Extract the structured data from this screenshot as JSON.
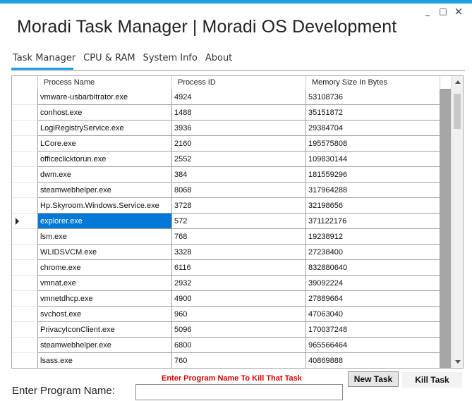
{
  "window": {
    "title": "Moradi Task Manager | Moradi OS Development",
    "minimize_glyph": "_",
    "maximize_glyph": "□",
    "close_glyph": "×",
    "accent_color": "#1ba1e2"
  },
  "tabs": [
    {
      "label": "Task Manager",
      "active": true
    },
    {
      "label": "CPU & RAM",
      "active": false
    },
    {
      "label": "System Info",
      "active": false
    },
    {
      "label": "About",
      "active": false
    }
  ],
  "grid": {
    "columns": [
      "Process Name",
      "Process ID",
      "Memory Size In Bytes"
    ],
    "selected_row": 8,
    "selection_color": "#0078d7",
    "rows": [
      [
        "vmware-usbarbitrator.exe",
        "4924",
        "53108736"
      ],
      [
        "conhost.exe",
        "1488",
        "35151872"
      ],
      [
        "LogiRegistryService.exe",
        "3936",
        "29384704"
      ],
      [
        "LCore.exe",
        "2160",
        "195575808"
      ],
      [
        "officeclicktorun.exe",
        "2552",
        "109830144"
      ],
      [
        "dwm.exe",
        "384",
        "181559296"
      ],
      [
        "steamwebhelper.exe",
        "8068",
        "317964288"
      ],
      [
        "Hp.Skyroom.Windows.Service.exe",
        "3728",
        "32198656"
      ],
      [
        "explorer.exe",
        "572",
        "371122176"
      ],
      [
        "lsm.exe",
        "768",
        "19238912"
      ],
      [
        "WLIDSVCM.exe",
        "3328",
        "27238400"
      ],
      [
        "chrome.exe",
        "6116",
        "832880640"
      ],
      [
        "vmnat.exe",
        "2932",
        "39092224"
      ],
      [
        "vmnetdhcp.exe",
        "4900",
        "27889664"
      ],
      [
        "svchost.exe",
        "960",
        "47063040"
      ],
      [
        "PrivacyIconClient.exe",
        "5096",
        "170037248"
      ],
      [
        "steamwebhelper.exe",
        "6800",
        "965566464"
      ],
      [
        "lsass.exe",
        "760",
        "40869888"
      ]
    ]
  },
  "hint": {
    "text": "Enter Program Name To Kill That Task",
    "color": "#e00000"
  },
  "buttons": {
    "new_task": "New Task",
    "kill_task": "Kill Task"
  },
  "prompt": {
    "label": "Enter Program Name:",
    "value": ""
  }
}
